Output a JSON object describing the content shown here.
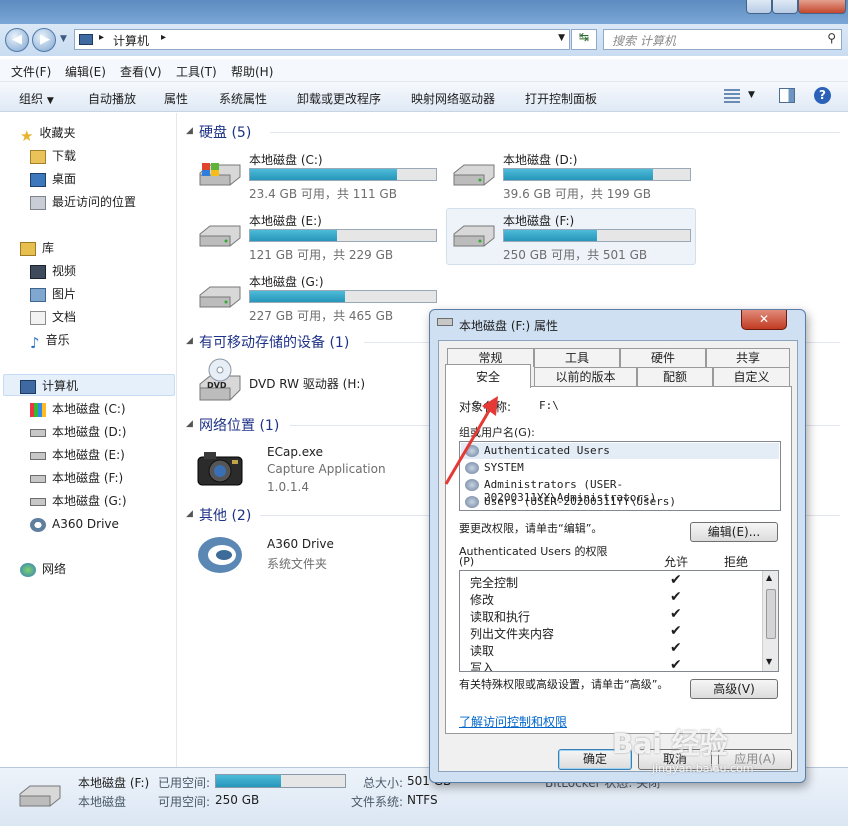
{
  "window": {
    "address": "计算机",
    "search_placeholder": "搜索 计算机"
  },
  "menu": [
    "文件(F)",
    "编辑(E)",
    "查看(V)",
    "工具(T)",
    "帮助(H)"
  ],
  "toolbar": [
    "组织",
    "自动播放",
    "属性",
    "系统属性",
    "卸载或更改程序",
    "映射网络驱动器",
    "打开控制面板"
  ],
  "nav": {
    "favorites": {
      "label": "收藏夹",
      "items": [
        "下载",
        "桌面",
        "最近访问的位置"
      ]
    },
    "library": {
      "label": "库",
      "items": [
        "视频",
        "图片",
        "文档",
        "音乐"
      ]
    },
    "computer": {
      "label": "计算机",
      "items": [
        "本地磁盘 (C:)",
        "本地磁盘 (D:)",
        "本地磁盘 (E:)",
        "本地磁盘 (F:)",
        "本地磁盘 (G:)",
        "A360 Drive"
      ]
    },
    "network": {
      "label": "网络"
    }
  },
  "sections": {
    "hdd": "硬盘 (5)",
    "removable": "有可移动存储的设备 (1)",
    "netloc": "网络位置 (1)",
    "other": "其他 (2)"
  },
  "drives": [
    {
      "name": "本地磁盘 (C:)",
      "info": "23.4 GB 可用，共 111 GB",
      "used": 0.79
    },
    {
      "name": "本地磁盘 (D:)",
      "info": "39.6 GB 可用，共 199 GB",
      "used": 0.8
    },
    {
      "name": "本地磁盘 (E:)",
      "info": "121 GB 可用，共 229 GB",
      "used": 0.47
    },
    {
      "name": "本地磁盘 (F:)",
      "info": "250 GB 可用，共 501 GB",
      "used": 0.5
    },
    {
      "name": "本地磁盘 (G:)",
      "info": "227 GB 可用，共 465 GB",
      "used": 0.51
    }
  ],
  "dvd": "DVD RW 驱动器 (H:)",
  "ecap": {
    "name": "ECap.exe",
    "desc": "Capture Application",
    "ver": "1.0.1.4"
  },
  "a360": {
    "name": "A360 Drive",
    "desc": "系统文件夹"
  },
  "status": {
    "name": "本地磁盘 (F:)",
    "type": "本地磁盘",
    "used_label": "已用空间:",
    "free_label": "可用空间:",
    "free": "250 GB",
    "total_label": "总大小:",
    "total": "501 GB",
    "fs_label": "文件系统:",
    "fs": "NTFS",
    "bitlocker": "BitLocker 状态: 关闭"
  },
  "dialog": {
    "title": "本地磁盘 (F:) 属性",
    "tabs_row1": [
      "常规",
      "工具",
      "硬件",
      "共享"
    ],
    "tabs_row2": [
      "安全",
      "以前的版本",
      "配额",
      "自定义"
    ],
    "object_label": "对象名称:",
    "object_value": "F:\\",
    "group_label": "组或用户名(G):",
    "users": [
      "Authenticated Users",
      "SYSTEM",
      "Administrators (USER-20200311YY\\Administrators)",
      "Users (USER-20200311YY\\Users)"
    ],
    "change_hint": "要更改权限，请单击“编辑”。",
    "edit_btn": "编辑(E)...",
    "perm_label": "Authenticated Users 的权限",
    "perm_p": "(P)",
    "allow": "允许",
    "deny": "拒绝",
    "perms": [
      "完全控制",
      "修改",
      "读取和执行",
      "列出文件夹内容",
      "读取",
      "写入"
    ],
    "adv_hint": "有关特殊权限或高级设置，请单击“高级”。",
    "adv_btn": "高级(V)",
    "link": "了解访问控制和权限",
    "ok": "确定",
    "cancel": "取消",
    "apply": "应用(A)"
  },
  "watermark": "Bai 经验",
  "watermark_url": "jingyan.baidu.com"
}
